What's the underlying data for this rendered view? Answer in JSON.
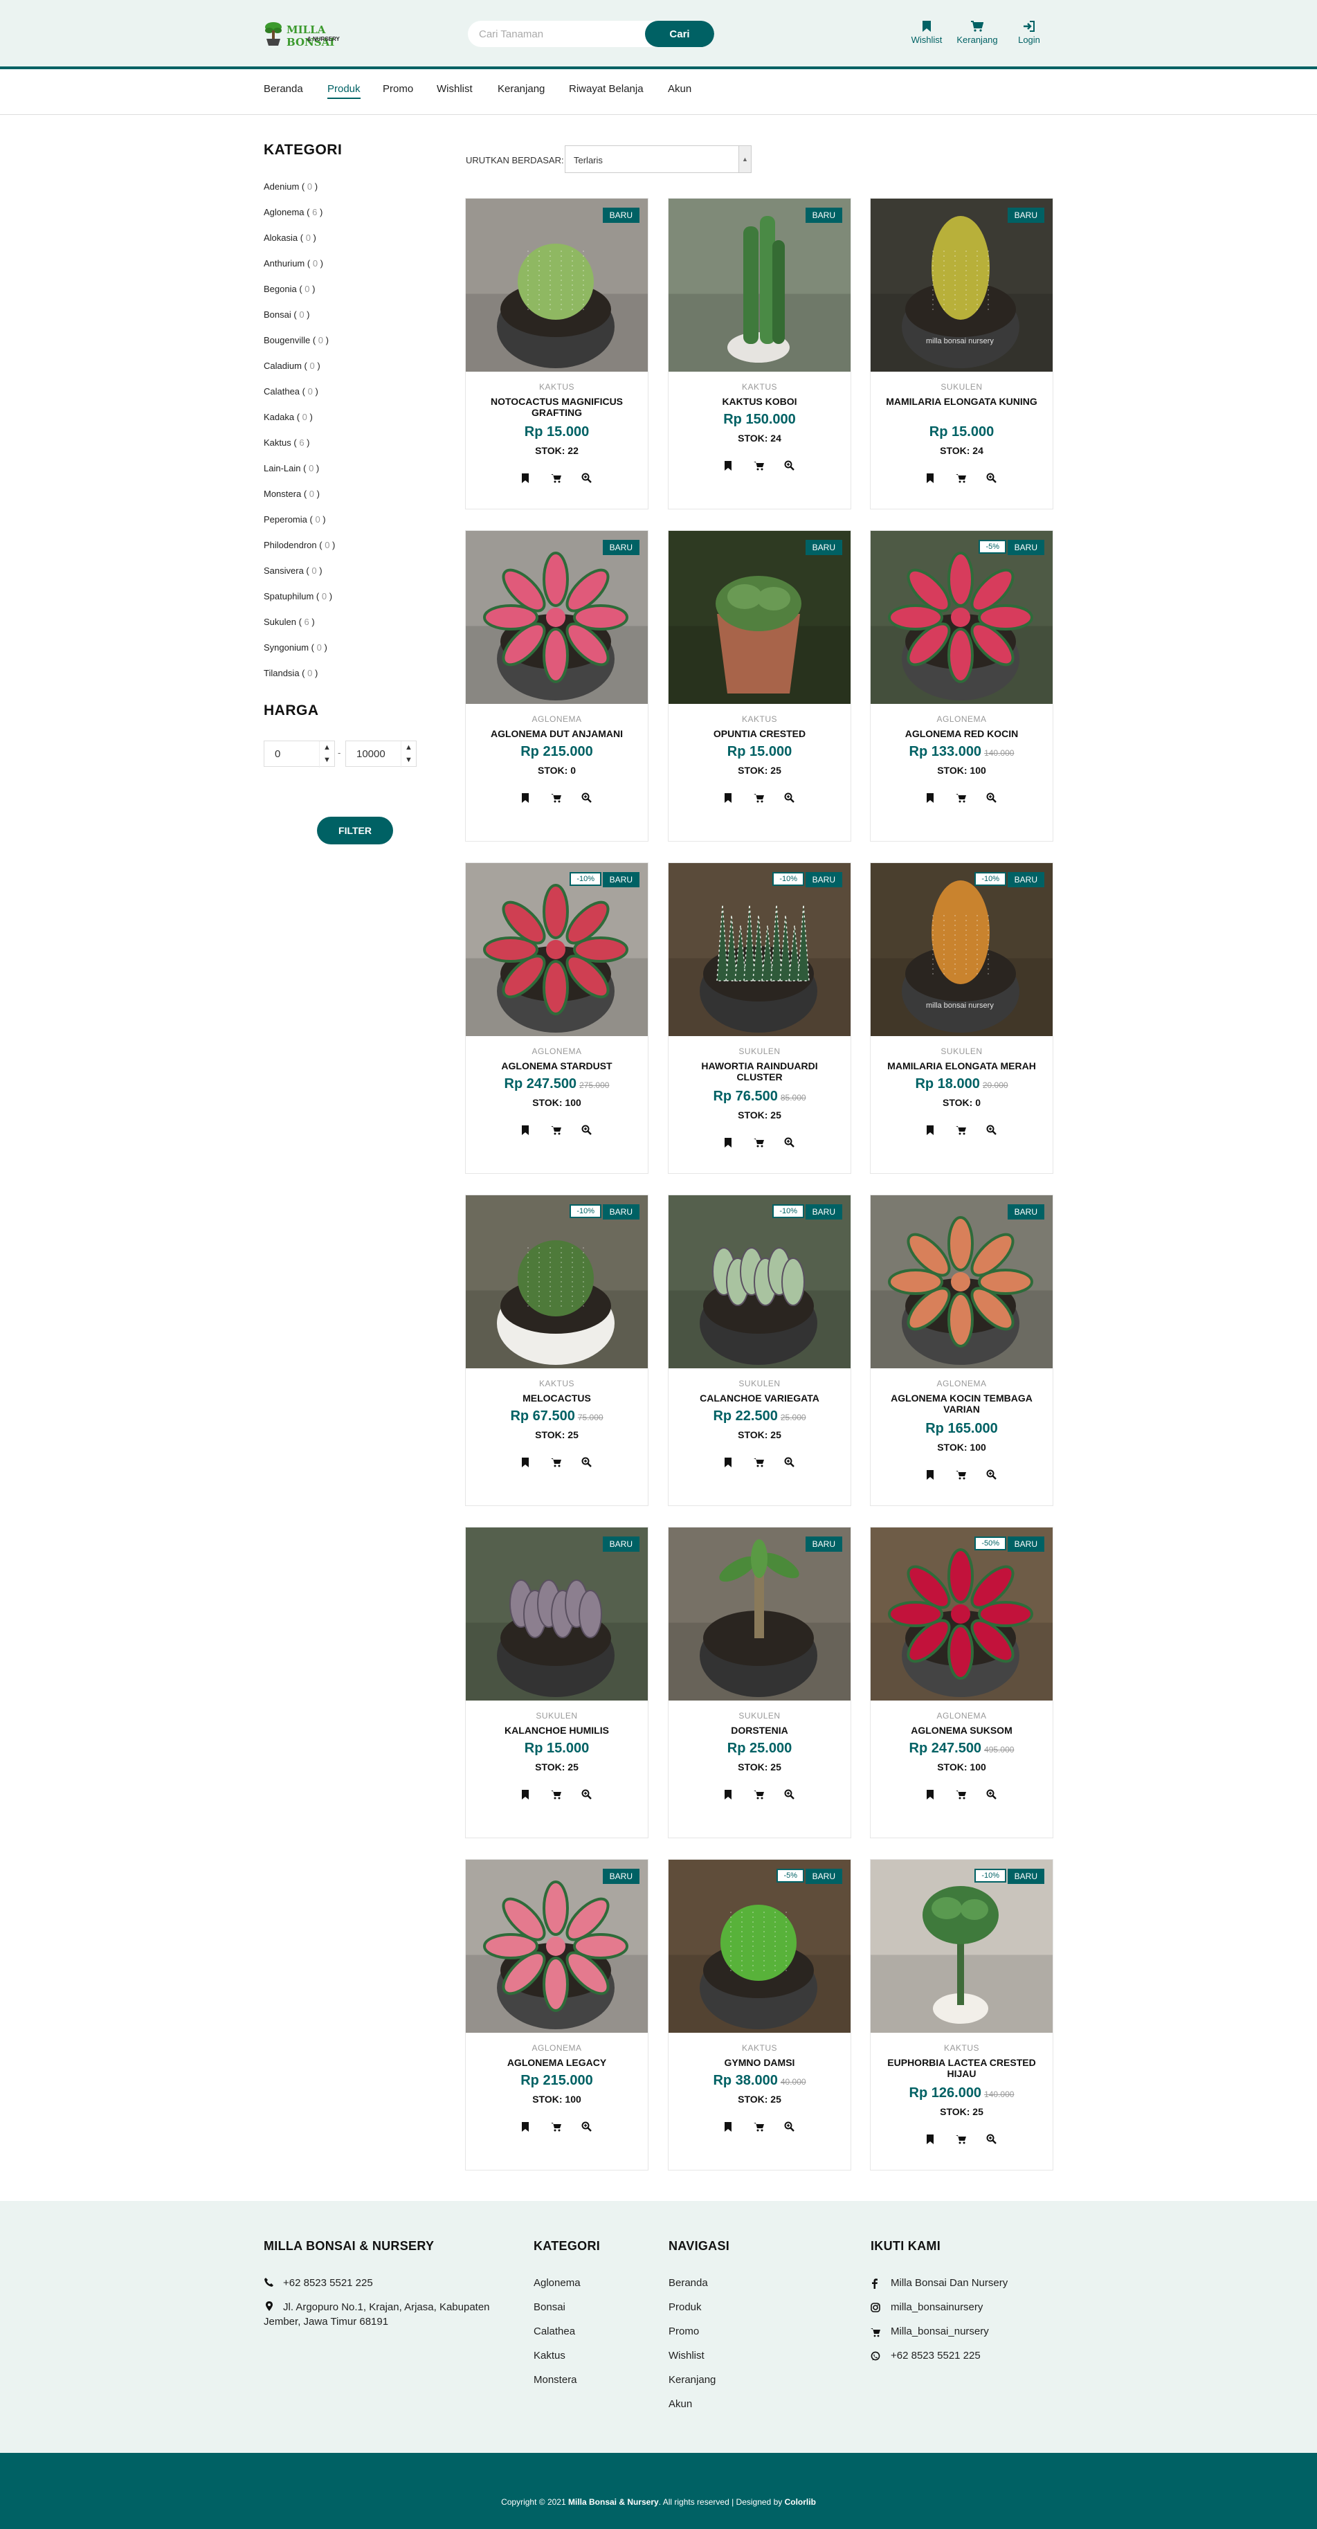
{
  "header": {
    "logo": {
      "line1": "MILLA BONSAI",
      "line2": "& NURSERY"
    },
    "search": {
      "placeholder": "Cari Tanaman",
      "button": "Cari"
    },
    "icons": [
      {
        "name": "bookmark-icon",
        "label": "Wishlist"
      },
      {
        "name": "cart-icon",
        "label": "Keranjang"
      },
      {
        "name": "login-icon",
        "label": "Login"
      }
    ]
  },
  "nav": {
    "items": [
      "Beranda",
      "Produk",
      "Promo",
      "Wishlist",
      "Keranjang",
      "Riwayat Belanja",
      "Akun"
    ],
    "active": "Produk"
  },
  "sidebar": {
    "category_title": "KATEGORI",
    "categories": [
      {
        "name": "Adenium",
        "count": "0"
      },
      {
        "name": "Aglonema",
        "count": "6"
      },
      {
        "name": "Alokasia",
        "count": "0"
      },
      {
        "name": "Anthurium",
        "count": "0"
      },
      {
        "name": "Begonia",
        "count": "0"
      },
      {
        "name": "Bonsai",
        "count": "0"
      },
      {
        "name": "Bougenville",
        "count": "0"
      },
      {
        "name": "Caladium",
        "count": "0"
      },
      {
        "name": "Calathea",
        "count": "0"
      },
      {
        "name": "Kadaka",
        "count": "0"
      },
      {
        "name": "Kaktus",
        "count": "6"
      },
      {
        "name": "Lain-Lain",
        "count": "0"
      },
      {
        "name": "Monstera",
        "count": "0"
      },
      {
        "name": "Peperomia",
        "count": "0"
      },
      {
        "name": "Philodendron",
        "count": "0"
      },
      {
        "name": "Sansivera",
        "count": "0"
      },
      {
        "name": "Spatuphilum",
        "count": "0"
      },
      {
        "name": "Sukulen",
        "count": "6"
      },
      {
        "name": "Syngonium",
        "count": "0"
      },
      {
        "name": "Tilandsia",
        "count": "0"
      }
    ],
    "price_title": "HARGA",
    "price_min": "0",
    "price_max": "10000",
    "price_sep": "-",
    "filter_button": "FILTER"
  },
  "sort": {
    "label": "URUTKAN BERDASAR:",
    "value": "Terlaris"
  },
  "products": [
    {
      "category": "KAKTUS",
      "name": "NOTOCACTUS MAGNIFICUS GRAFTING",
      "price": "Rp 15.000",
      "old_price": "",
      "stock": "STOK: 22",
      "badge_new": "BARU",
      "badge_disc": "",
      "image": "cactus-round-white",
      "watermark": ""
    },
    {
      "category": "KAKTUS",
      "name": "KAKTUS KOBOI",
      "price": "Rp 150.000",
      "old_price": "",
      "stock": "STOK: 24",
      "badge_new": "BARU",
      "badge_disc": "",
      "image": "cactus-columnar",
      "watermark": ""
    },
    {
      "category": "SUKULEN",
      "name": "MAMILARIA ELONGATA KUNING",
      "price": "Rp 15.000",
      "old_price": "",
      "stock": "STOK: 24",
      "badge_new": "BARU",
      "badge_disc": "",
      "image": "cactus-yellow",
      "watermark": "milla bonsai nursery"
    },
    {
      "category": "AGLONEMA",
      "name": "AGLONEMA DUT ANJAMANI",
      "price": "Rp 215.000",
      "old_price": "",
      "stock": "STOK: 0",
      "badge_new": "BARU",
      "badge_disc": "",
      "image": "aglonema-pink",
      "watermark": ""
    },
    {
      "category": "KAKTUS",
      "name": "OPUNTIA CRESTED",
      "price": "Rp 15.000",
      "old_price": "",
      "stock": "STOK: 25",
      "badge_new": "BARU",
      "badge_disc": "",
      "image": "cactus-crested-clay",
      "watermark": ""
    },
    {
      "category": "AGLONEMA",
      "name": "AGLONEMA RED KOCIN",
      "price": "Rp 133.000",
      "old_price": "140.000",
      "stock": "STOK: 100",
      "badge_new": "BARU",
      "badge_disc": "-5%",
      "image": "aglonema-red",
      "watermark": ""
    },
    {
      "category": "AGLONEMA",
      "name": "AGLONEMA STARDUST",
      "price": "Rp 247.500",
      "old_price": "275.000",
      "stock": "STOK: 100",
      "badge_new": "BARU",
      "badge_disc": "-10%",
      "image": "aglonema-stardust",
      "watermark": ""
    },
    {
      "category": "SUKULEN",
      "name": "HAWORTIA RAINDUARDI CLUSTER",
      "price": "Rp 76.500",
      "old_price": "85.000",
      "stock": "STOK: 25",
      "badge_new": "BARU",
      "badge_disc": "-10%",
      "image": "haworthia",
      "watermark": ""
    },
    {
      "category": "SUKULEN",
      "name": "MAMILARIA ELONGATA MERAH",
      "price": "Rp 18.000",
      "old_price": "20.000",
      "stock": "STOK: 0",
      "badge_new": "BARU",
      "badge_disc": "-10%",
      "image": "cactus-orange",
      "watermark": "milla bonsai nursery"
    },
    {
      "category": "KAKTUS",
      "name": "MELOCACTUS",
      "price": "Rp 67.500",
      "old_price": "75.000",
      "stock": "STOK: 25",
      "badge_new": "BARU",
      "badge_disc": "-10%",
      "image": "melocactus",
      "watermark": ""
    },
    {
      "category": "SUKULEN",
      "name": "CALANCHOE VARIEGATA",
      "price": "Rp 22.500",
      "old_price": "25.000",
      "stock": "STOK: 25",
      "badge_new": "BARU",
      "badge_disc": "-10%",
      "image": "kalanchoe-var",
      "watermark": ""
    },
    {
      "category": "AGLONEMA",
      "name": "AGLONEMA KOCIN TEMBAGA VARIAN",
      "price": "Rp 165.000",
      "old_price": "",
      "stock": "STOK: 100",
      "badge_new": "BARU",
      "badge_disc": "",
      "image": "aglonema-copper",
      "watermark": ""
    },
    {
      "category": "SUKULEN",
      "name": "KALANCHOE HUMILIS",
      "price": "Rp 15.000",
      "old_price": "",
      "stock": "STOK: 25",
      "badge_new": "BARU",
      "badge_disc": "",
      "image": "kalanchoe-humilis",
      "watermark": ""
    },
    {
      "category": "SUKULEN",
      "name": "DORSTENIA",
      "price": "Rp 25.000",
      "old_price": "",
      "stock": "STOK: 25",
      "badge_new": "BARU",
      "badge_disc": "",
      "image": "dorstenia",
      "watermark": ""
    },
    {
      "category": "AGLONEMA",
      "name": "AGLONEMA SUKSOM",
      "price": "Rp 247.500",
      "old_price": "495.000",
      "stock": "STOK: 100",
      "badge_new": "BARU",
      "badge_disc": "-50%",
      "image": "aglonema-suksom",
      "watermark": ""
    },
    {
      "category": "AGLONEMA",
      "name": "AGLONEMA LEGACY",
      "price": "Rp 215.000",
      "old_price": "",
      "stock": "STOK: 100",
      "badge_new": "BARU",
      "badge_disc": "",
      "image": "aglonema-legacy",
      "watermark": ""
    },
    {
      "category": "KAKTUS",
      "name": "GYMNO DAMSI",
      "price": "Rp 38.000",
      "old_price": "40.000",
      "stock": "STOK: 25",
      "badge_new": "BARU",
      "badge_disc": "-5%",
      "image": "gymno-green",
      "watermark": ""
    },
    {
      "category": "KAKTUS",
      "name": "EUPHORBIA LACTEA CRESTED HIJAU",
      "price": "Rp 126.000",
      "old_price": "140.000",
      "stock": "STOK: 25",
      "badge_new": "BARU",
      "badge_disc": "-10%",
      "image": "euphorbia",
      "watermark": ""
    }
  ],
  "footer": {
    "brand": {
      "title": "MILLA BONSAI & NURSERY",
      "phone": "+62 8523 5521 225",
      "address_line1": "Jl. Argopuro No.1, Krajan, Arjasa, Kabupaten",
      "address_line2": "Jember, Jawa Timur 68191"
    },
    "kategori": {
      "title": "KATEGORI",
      "items": [
        "Aglonema",
        "Bonsai",
        "Calathea",
        "Kaktus",
        "Monstera"
      ]
    },
    "navigasi": {
      "title": "NAVIGASI",
      "items": [
        "Beranda",
        "Produk",
        "Promo",
        "Wishlist",
        "Keranjang",
        "Akun"
      ]
    },
    "ikuti": {
      "title": "IKUTI KAMI",
      "items": [
        {
          "icon": "facebook-icon",
          "label": "Milla Bonsai Dan Nursery"
        },
        {
          "icon": "instagram-icon",
          "label": "milla_bonsainursery"
        },
        {
          "icon": "cart-icon",
          "label": "Milla_bonsai_nursery"
        },
        {
          "icon": "whatsapp-icon",
          "label": "+62 8523 5521 225"
        }
      ]
    }
  },
  "copyright": {
    "prefix": "Copyright © 2021",
    "brand": "Milla Bonsai & Nursery",
    "middle": ". All rights reserved | Designed by",
    "designer": "Colorlib"
  },
  "colors": {
    "primary": "#006164",
    "bg_light": "#ebf3f1"
  }
}
